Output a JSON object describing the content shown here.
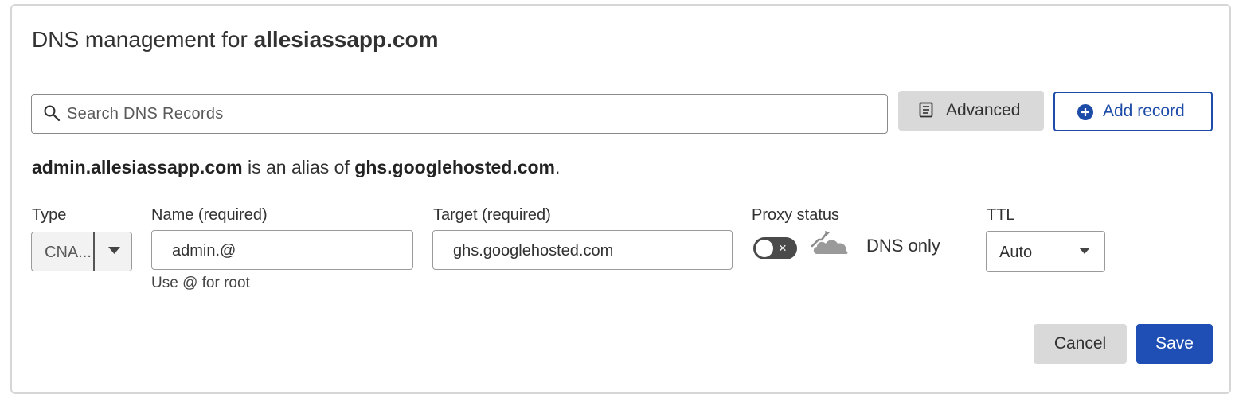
{
  "header": {
    "title_prefix": "DNS management for",
    "domain": "allesiassapp.com"
  },
  "toolbar": {
    "search_placeholder": "Search DNS Records",
    "advanced_label": "Advanced",
    "add_record_label": "Add record"
  },
  "alias_notice": {
    "name": "admin.allesiassapp.com",
    "middle": "is an alias of",
    "target": "ghs.googlehosted.com",
    "end": "."
  },
  "record_form": {
    "type": {
      "label": "Type",
      "value": "CNA..."
    },
    "name": {
      "label": "Name (required)",
      "value": "admin.@",
      "hint": "Use @ for root"
    },
    "target": {
      "label": "Target (required)",
      "value": "ghs.googlehosted.com"
    },
    "proxy": {
      "label": "Proxy status",
      "enabled": false,
      "toggle_off_glyph": "×",
      "status_text": "DNS only"
    },
    "ttl": {
      "label": "TTL",
      "value": "Auto"
    }
  },
  "actions": {
    "cancel_label": "Cancel",
    "save_label": "Save"
  },
  "colors": {
    "primary": "#1f4fb5",
    "primary_outline": "#1d4ba8",
    "secondary_button": "#d9d9d9",
    "toggle_off": "#4a4a4a"
  },
  "icons": {
    "search": "search-icon",
    "advanced": "document-icon",
    "add": "plus-circle-icon",
    "proxy": "cloud-dns-only-icon",
    "caret": "caret-down-icon"
  }
}
